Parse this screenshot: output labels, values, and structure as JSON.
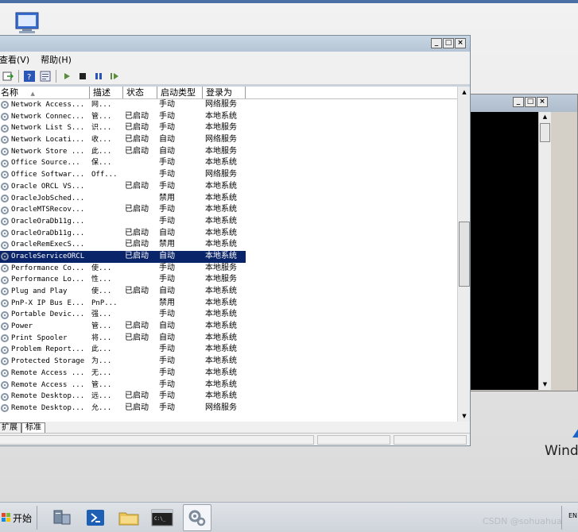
{
  "menu": {
    "items": [
      "查看(V)",
      "帮助(H)"
    ]
  },
  "columns": {
    "name": "名称",
    "desc": "描述",
    "status": "状态",
    "startup": "启动类型",
    "logon": "登录为"
  },
  "services": [
    {
      "name": "Network Access...",
      "desc": "网...",
      "status": "",
      "startup": "手动",
      "logon": "网络服务"
    },
    {
      "name": "Network Connec...",
      "desc": "管...",
      "status": "已启动",
      "startup": "手动",
      "logon": "本地系统"
    },
    {
      "name": "Network List S...",
      "desc": "识...",
      "status": "已启动",
      "startup": "手动",
      "logon": "本地服务"
    },
    {
      "name": "Network Locati...",
      "desc": "收...",
      "status": "已启动",
      "startup": "自动",
      "logon": "网络服务"
    },
    {
      "name": "Network Store ...",
      "desc": "此...",
      "status": "已启动",
      "startup": "自动",
      "logon": "本地服务"
    },
    {
      "name": "Office  Source...",
      "desc": "保...",
      "status": "",
      "startup": "手动",
      "logon": "本地系统"
    },
    {
      "name": "Office Softwar...",
      "desc": "Off...",
      "status": "",
      "startup": "手动",
      "logon": "网络服务"
    },
    {
      "name": "Oracle ORCL VS...",
      "desc": "",
      "status": "已启动",
      "startup": "手动",
      "logon": "本地系统"
    },
    {
      "name": "OracleJobSched...",
      "desc": "",
      "status": "",
      "startup": "禁用",
      "logon": "本地系统"
    },
    {
      "name": "OracleMTSRecov...",
      "desc": "",
      "status": "已启动",
      "startup": "手动",
      "logon": "本地系统"
    },
    {
      "name": "OracleOraDb11g...",
      "desc": "",
      "status": "",
      "startup": "手动",
      "logon": "本地系统"
    },
    {
      "name": "OracleOraDb11g...",
      "desc": "",
      "status": "已启动",
      "startup": "自动",
      "logon": "本地系统"
    },
    {
      "name": "OracleRemExecS...",
      "desc": "",
      "status": "已启动",
      "startup": "禁用",
      "logon": "本地系统"
    },
    {
      "name": "OracleServiceORCL",
      "desc": "",
      "status": "已启动",
      "startup": "自动",
      "logon": "本地系统"
    },
    {
      "name": "Performance Co...",
      "desc": "使...",
      "status": "",
      "startup": "手动",
      "logon": "本地服务"
    },
    {
      "name": "Performance Lo...",
      "desc": "性...",
      "status": "",
      "startup": "手动",
      "logon": "本地服务"
    },
    {
      "name": "Plug and Play",
      "desc": "使...",
      "status": "已启动",
      "startup": "自动",
      "logon": "本地系统"
    },
    {
      "name": "PnP-X IP Bus E...",
      "desc": "PnP...",
      "status": "",
      "startup": "禁用",
      "logon": "本地系统"
    },
    {
      "name": "Portable Devic...",
      "desc": "强...",
      "status": "",
      "startup": "手动",
      "logon": "本地系统"
    },
    {
      "name": "Power",
      "desc": "管...",
      "status": "已启动",
      "startup": "自动",
      "logon": "本地系统"
    },
    {
      "name": "Print Spooler",
      "desc": "将...",
      "status": "已启动",
      "startup": "自动",
      "logon": "本地系统"
    },
    {
      "name": "Problem Report...",
      "desc": "此...",
      "status": "",
      "startup": "手动",
      "logon": "本地系统"
    },
    {
      "name": "Protected Storage",
      "desc": "为...",
      "status": "",
      "startup": "手动",
      "logon": "本地系统"
    },
    {
      "name": "Remote Access ...",
      "desc": "无...",
      "status": "",
      "startup": "手动",
      "logon": "本地系统"
    },
    {
      "name": "Remote Access ...",
      "desc": "管...",
      "status": "",
      "startup": "手动",
      "logon": "本地系统"
    },
    {
      "name": "Remote Desktop...",
      "desc": "远...",
      "status": "已启动",
      "startup": "手动",
      "logon": "本地系统"
    },
    {
      "name": "Remote Desktop...",
      "desc": "允...",
      "status": "已启动",
      "startup": "手动",
      "logon": "网络服务"
    }
  ],
  "selected_index": 13,
  "tabs": [
    "扩展",
    "标准"
  ],
  "taskbar": {
    "start_label": "开始",
    "lang": "EN"
  },
  "desktop": {
    "win_text": "Wind",
    "watermark": "CSDN @sohuahua"
  },
  "colors": {
    "selection": "#0a246a",
    "console_bg": "#000000"
  },
  "icons": [
    "computer-icon",
    "gear-icon",
    "sort-up-icon",
    "play-icon",
    "stop-icon",
    "pause-icon",
    "resume-icon",
    "server-manager-icon",
    "powershell-icon",
    "folder-icon",
    "cmd-icon",
    "services-icon"
  ]
}
